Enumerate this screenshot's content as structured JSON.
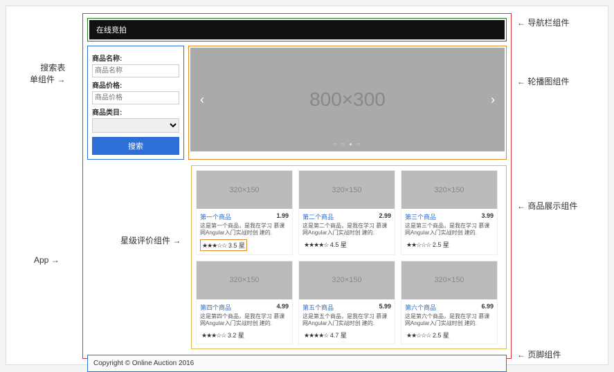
{
  "annotations": {
    "app": "App",
    "navbar": "导航栏组件",
    "search": "搜索表\n单组件",
    "carousel": "轮播图组件",
    "products": "商品展示组件",
    "rating": "星级评价组件",
    "footer": "页脚组件"
  },
  "navbar": {
    "brand": "在线竞拍"
  },
  "search": {
    "name_label": "商品名称:",
    "name_placeholder": "商品名称",
    "price_label": "商品价格:",
    "price_placeholder": "商品价格",
    "category_label": "商品类目:",
    "category_value": "",
    "submit": "搜索"
  },
  "carousel": {
    "placeholder": "800×300",
    "prev": "‹",
    "next": "›",
    "dots": "○ ○ ● ○"
  },
  "products": [
    {
      "title": "第一个商品",
      "price": "1.99",
      "desc": "这是第一个商品，是我在学习\n慕课网Angular入门实战时创\n建的.",
      "stars": "★★★☆☆",
      "rating_text": "3.5 星",
      "highlight_rating": true
    },
    {
      "title": "第二个商品",
      "price": "2.99",
      "desc": "这是第二个商品，是我在学习\n慕课网Angular入门实战时创\n建的.",
      "stars": "★★★★☆",
      "rating_text": "4.5 星",
      "highlight_rating": false
    },
    {
      "title": "第三个商品",
      "price": "3.99",
      "desc": "这是第三个商品，是我在学习\n慕课网Angular入门实战时创\n建的.",
      "stars": "★★☆☆☆",
      "rating_text": "2.5 星",
      "highlight_rating": false
    },
    {
      "title": "第四个商品",
      "price": "4.99",
      "desc": "这是第四个商品，是我在学习\n慕课网Angular入门实战时创\n建的.",
      "stars": "★★★☆☆",
      "rating_text": "3.2 星",
      "highlight_rating": false
    },
    {
      "title": "第五个商品",
      "price": "5.99",
      "desc": "这是第五个商品，是我在学习\n慕课网Angular入门实战时创\n建的.",
      "stars": "★★★★☆",
      "rating_text": "4.7 星",
      "highlight_rating": false
    },
    {
      "title": "第六个商品",
      "price": "6.99",
      "desc": "这是第六个商品，是我在学习\n慕课网Angular入门实战时创\n建的.",
      "stars": "★★☆☆☆",
      "rating_text": "2.5 星",
      "highlight_rating": false
    }
  ],
  "product_image_placeholder": "320×150",
  "footer": {
    "text": "Copyright © Online Auction 2016"
  }
}
